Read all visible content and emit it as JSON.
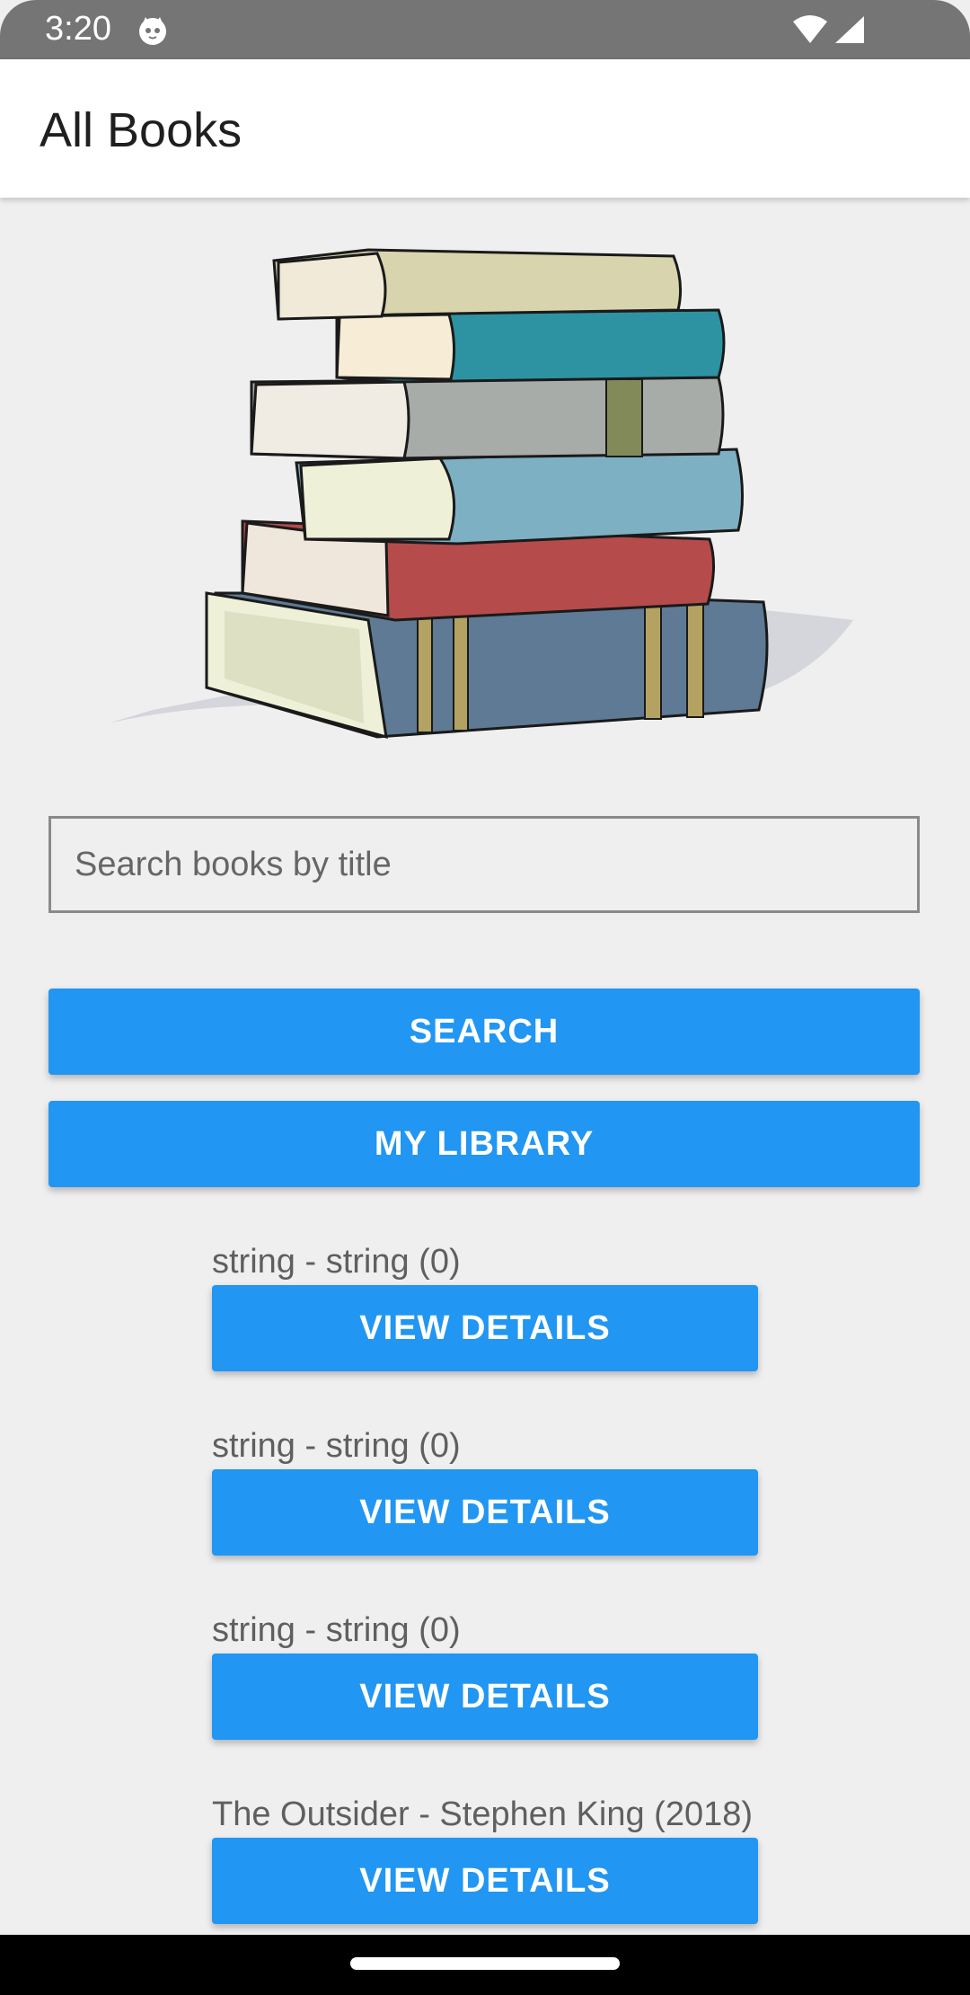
{
  "status_bar": {
    "time": "3:20",
    "icons": [
      "cat-icon",
      "wifi-icon",
      "signal-icon"
    ]
  },
  "app_bar": {
    "title": "All Books"
  },
  "illustration": {
    "icon": "stack-of-books-icon"
  },
  "search": {
    "placeholder": "Search books by title",
    "value": "",
    "button_label": "SEARCH"
  },
  "library": {
    "button_label": "MY LIBRARY"
  },
  "books": [
    {
      "label": "string - string (0)",
      "button_label": "VIEW DETAILS"
    },
    {
      "label": "string - string (0)",
      "button_label": "VIEW DETAILS"
    },
    {
      "label": "string - string (0)",
      "button_label": "VIEW DETAILS"
    },
    {
      "label": "The Outsider - Stephen King (2018)",
      "button_label": "VIEW DETAILS"
    }
  ],
  "colors": {
    "accent": "#2196f3",
    "status_bar": "#757575",
    "background": "#f0eff0"
  }
}
